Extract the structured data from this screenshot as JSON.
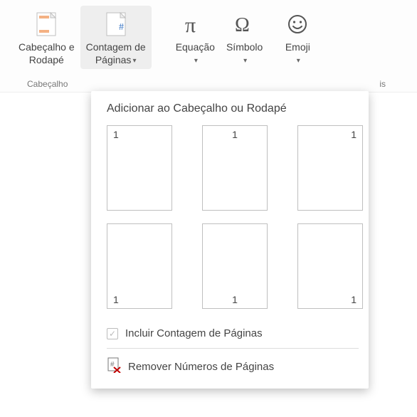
{
  "ribbon": {
    "buttons": {
      "header_footer": {
        "line1": "Cabeçalho e",
        "line2": "Rodapé"
      },
      "page_count": {
        "line1": "Contagem de",
        "line2": "Páginas"
      },
      "equation": {
        "line1": "Equação"
      },
      "symbol": {
        "line1": "Símbolo"
      },
      "emoji": {
        "line1": "Emoji"
      }
    },
    "group1": "Cabeçalho",
    "group2_suffix": "is"
  },
  "dropdown": {
    "title": "Adicionar ao Cabeçalho ou Rodapé",
    "sample_number": "1",
    "include_label": "Incluir Contagem de Páginas",
    "remove_label": "Remover Números de Páginas"
  }
}
